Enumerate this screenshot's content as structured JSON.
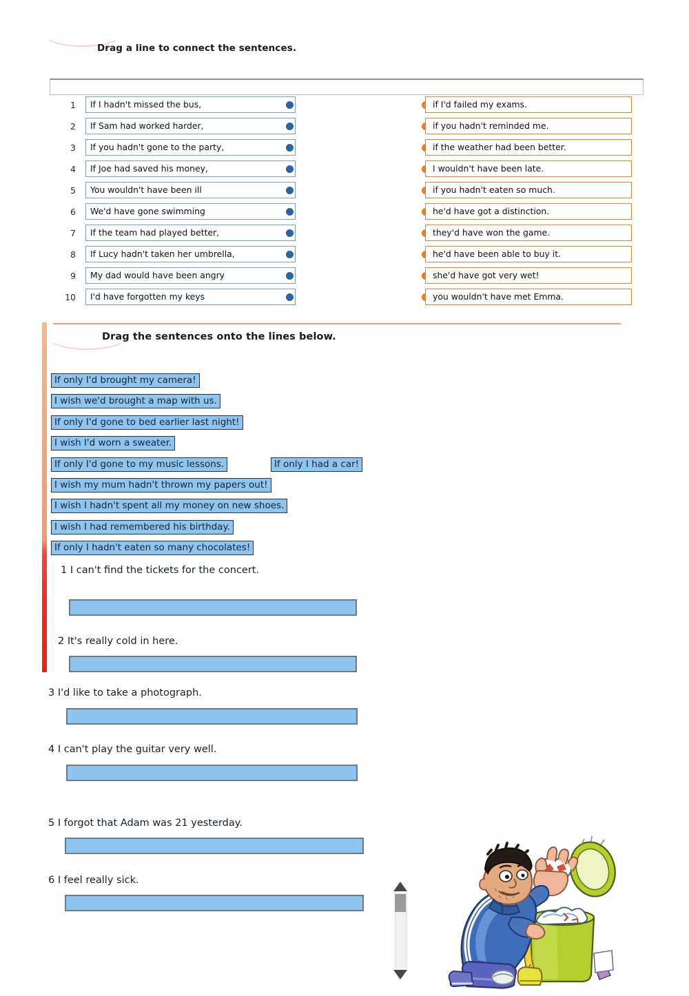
{
  "section_one": {
    "instruction": "Drag a line to connect the sentences.",
    "left_items": [
      {
        "n": "1",
        "text": "If I hadn't missed the bus,"
      },
      {
        "n": "2",
        "text": "If Sam had worked harder,"
      },
      {
        "n": "3",
        "text": "If you hadn't gone to the party,"
      },
      {
        "n": "4",
        "text": "If Joe had saved his money,"
      },
      {
        "n": "5",
        "text": "You wouldn't have been ill"
      },
      {
        "n": "6",
        "text": "We'd have gone swimming"
      },
      {
        "n": "7",
        "text": "If the team had played better,"
      },
      {
        "n": "8",
        "text": "If Lucy hadn't taken her umbrella,"
      },
      {
        "n": "9",
        "text": "My dad would have been angry"
      },
      {
        "n": "10",
        "text": "I'd have forgotten my keys"
      }
    ],
    "right_items": [
      {
        "text": "if I'd failed my exams."
      },
      {
        "text": "if you hadn't reminded me."
      },
      {
        "text": "if the weather had been better."
      },
      {
        "text": "I wouldn't have been late."
      },
      {
        "text": "if you hadn't eaten so much."
      },
      {
        "text": "he'd have got a distinction."
      },
      {
        "text": "they'd have won the game."
      },
      {
        "text": "he'd have been able to buy it."
      },
      {
        "text": "she'd have got very wet!"
      },
      {
        "text": "you wouldn't have met Emma."
      }
    ]
  },
  "section_two": {
    "instruction": "Drag the sentences onto the lines below.",
    "drag_chips": [
      "If only I'd brought my camera!",
      "I wish we'd brought a map with us.",
      "If only I'd gone to bed earlier last night!",
      "I wish I'd worn a sweater.",
      "If only I'd gone to my music lessons.",
      "If only I had a car!",
      "I wish my mum hadn't thrown my papers out!",
      "I wish I hadn't spent all my money on new shoes.",
      "I wish I had remembered his birthday.",
      "If only I hadn't eaten so many chocolates!"
    ],
    "prompts": [
      {
        "n": "1",
        "text": "I can't find the tickets for the concert."
      },
      {
        "n": "2",
        "text": "It's really cold in here."
      },
      {
        "n": "3",
        "text": "I'd like to take a photograph."
      },
      {
        "n": "4",
        "text": "I can't play the guitar very well."
      },
      {
        "n": "5",
        "text": "I forgot that Adam was 21 yesterday."
      },
      {
        "n": "6",
        "text": "I feel really sick."
      }
    ],
    "scrollbar": {
      "up_label": "scroll up",
      "down_label": "scroll down"
    },
    "illustration_alt": "Boy in blue tracksuit searching through a green rubbish bin"
  },
  "colors": {
    "left_box_border": "#7d9cc4",
    "left_dot": "#2a63a8",
    "right_box_border": "#e08428",
    "right_dot": "#f07d18",
    "chip_fill": "#8ec4f0",
    "chip_border": "#2e3338",
    "blank_fill": "#8ec4f0",
    "blank_border": "#6e7a82",
    "rule": "#ed9a8a"
  }
}
